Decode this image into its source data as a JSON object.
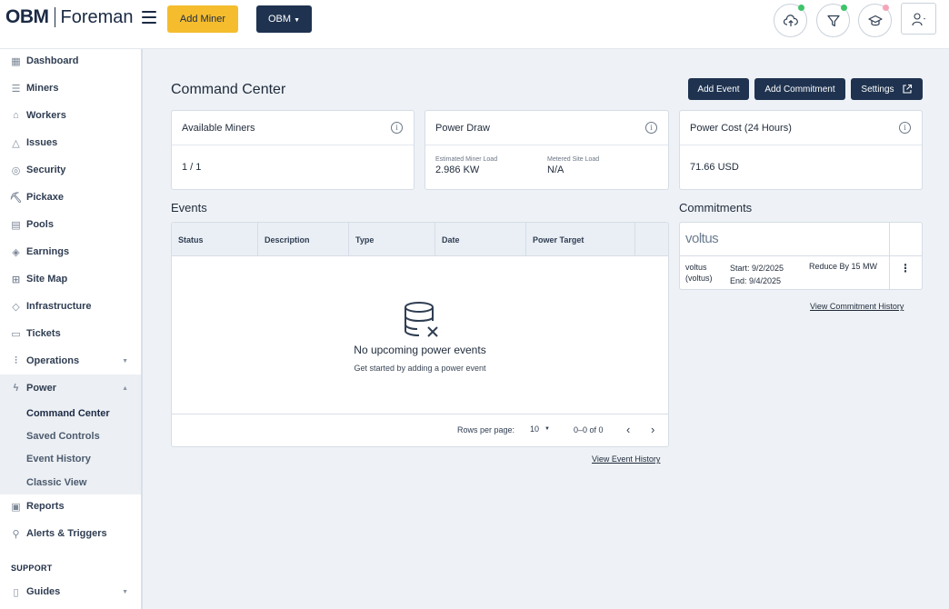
{
  "header": {
    "logo_brand": "OBM",
    "logo_product": "Foreman",
    "add_miner_label": "Add Miner",
    "org_dropdown_label": "OBM",
    "status_colors": {
      "green": "#3fc36b",
      "pink": "#f4a6b8"
    }
  },
  "sidebar": {
    "items": [
      {
        "label": "Dashboard",
        "icon": "dashboard-icon"
      },
      {
        "label": "Miners",
        "icon": "server-icon"
      },
      {
        "label": "Workers",
        "icon": "worker-icon"
      },
      {
        "label": "Issues",
        "icon": "warning-icon"
      },
      {
        "label": "Security",
        "icon": "shield-icon"
      },
      {
        "label": "Pickaxe",
        "icon": "pickaxe-icon"
      },
      {
        "label": "Pools",
        "icon": "pool-icon"
      },
      {
        "label": "Earnings",
        "icon": "coins-icon"
      },
      {
        "label": "Site Map",
        "icon": "map-icon"
      },
      {
        "label": "Infrastructure",
        "icon": "layers-icon"
      },
      {
        "label": "Tickets",
        "icon": "ticket-icon"
      },
      {
        "label": "Operations",
        "icon": "sliders-icon"
      },
      {
        "label": "Power",
        "icon": "lightning-icon"
      },
      {
        "label": "Reports",
        "icon": "report-icon"
      },
      {
        "label": "Alerts & Triggers",
        "icon": "alert-icon"
      },
      {
        "label": "Guides",
        "icon": "book-icon"
      }
    ],
    "power_subitems": [
      "Command Center",
      "Saved Controls",
      "Event History",
      "Classic View"
    ],
    "support_label": "SUPPORT"
  },
  "main": {
    "title": "Command Center",
    "buttons": {
      "add_event": "Add Event",
      "add_commitment": "Add Commitment",
      "settings": "Settings"
    },
    "cards": {
      "available_miners": {
        "title": "Available Miners",
        "value": "1 / 1"
      },
      "power_draw": {
        "title": "Power Draw",
        "estimated_label": "Estimated Miner Load",
        "estimated_value": "2.986 KW",
        "metered_label": "Metered Site Load",
        "metered_value": "N/A"
      },
      "power_cost": {
        "title": "Power Cost (24 Hours)",
        "value": "71.66 USD"
      }
    },
    "events": {
      "title": "Events",
      "columns": [
        "Status",
        "Description",
        "Type",
        "Date",
        "Power Target"
      ],
      "empty_title": "No upcoming power events",
      "empty_subtitle": "Get started by adding a power event",
      "rows_per_page_label": "Rows per page:",
      "rows_per_page_value": "10",
      "range_text": "0–0 of 0",
      "view_history_link": "View Event History"
    },
    "commitments": {
      "title": "Commitments",
      "logo_text": "voltus",
      "name": "voltus",
      "name_sub": "(voltus)",
      "start": "Start: 9/2/2025",
      "end": "End: 9/4/2025",
      "reduction": "Reduce By 15 MW",
      "view_history_link": "View Commitment History"
    }
  }
}
